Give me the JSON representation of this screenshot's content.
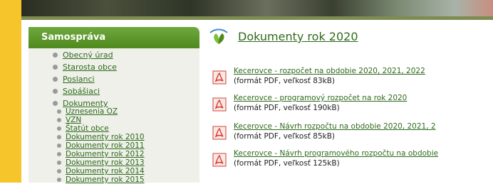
{
  "sidebar": {
    "title": "Samospráva",
    "items": [
      {
        "label": "Obecný úrad"
      },
      {
        "label": "Starosta obce"
      },
      {
        "label": "Poslanci"
      },
      {
        "label": "Sobášiaci"
      },
      {
        "label": "Dokumenty"
      }
    ],
    "sub_items": [
      {
        "label": "Uznesenia OZ"
      },
      {
        "label": "VZN"
      },
      {
        "label": "Štatút obce"
      },
      {
        "label": "Dokumenty rok 2010"
      },
      {
        "label": "Dokumenty rok 2011"
      },
      {
        "label": "Dokumenty rok 2012"
      },
      {
        "label": "Dokumenty rok 2013"
      },
      {
        "label": "Dokumenty rok 2014"
      },
      {
        "label": "Dokumenty rok 2015"
      }
    ]
  },
  "main": {
    "title": "Dokumenty rok 2020",
    "documents": [
      {
        "title": "Kecerovce - rozpočet na obdobie 2020, 2021, 2022",
        "meta": "(formát PDF, veľkosť 83kB)"
      },
      {
        "title": "Kecerovce - programový rozpočet na rok 2020",
        "meta": "(formát PDF, veľkosť 190kB)"
      },
      {
        "title": "Kecerovce - Návrh rozpočtu na obdobie 2020, 2021, 2",
        "meta": "(formát PDF, veľkosť 85kB)"
      },
      {
        "title": "Kecerovce - Návrh programového rozpočtu na obdobie",
        "meta": "(formát PDF, veľkosť 125kB)"
      }
    ]
  },
  "colors": {
    "accent_yellow": "#f6c42b",
    "header_green": "#5a9a2a",
    "link_green": "#2f6a1c",
    "pdf_red": "#d63a2b"
  },
  "icons": {
    "title_icon": "leaf-logo-icon",
    "doc_icon": "pdf-icon",
    "bullet_icon": "bullet-icon"
  }
}
